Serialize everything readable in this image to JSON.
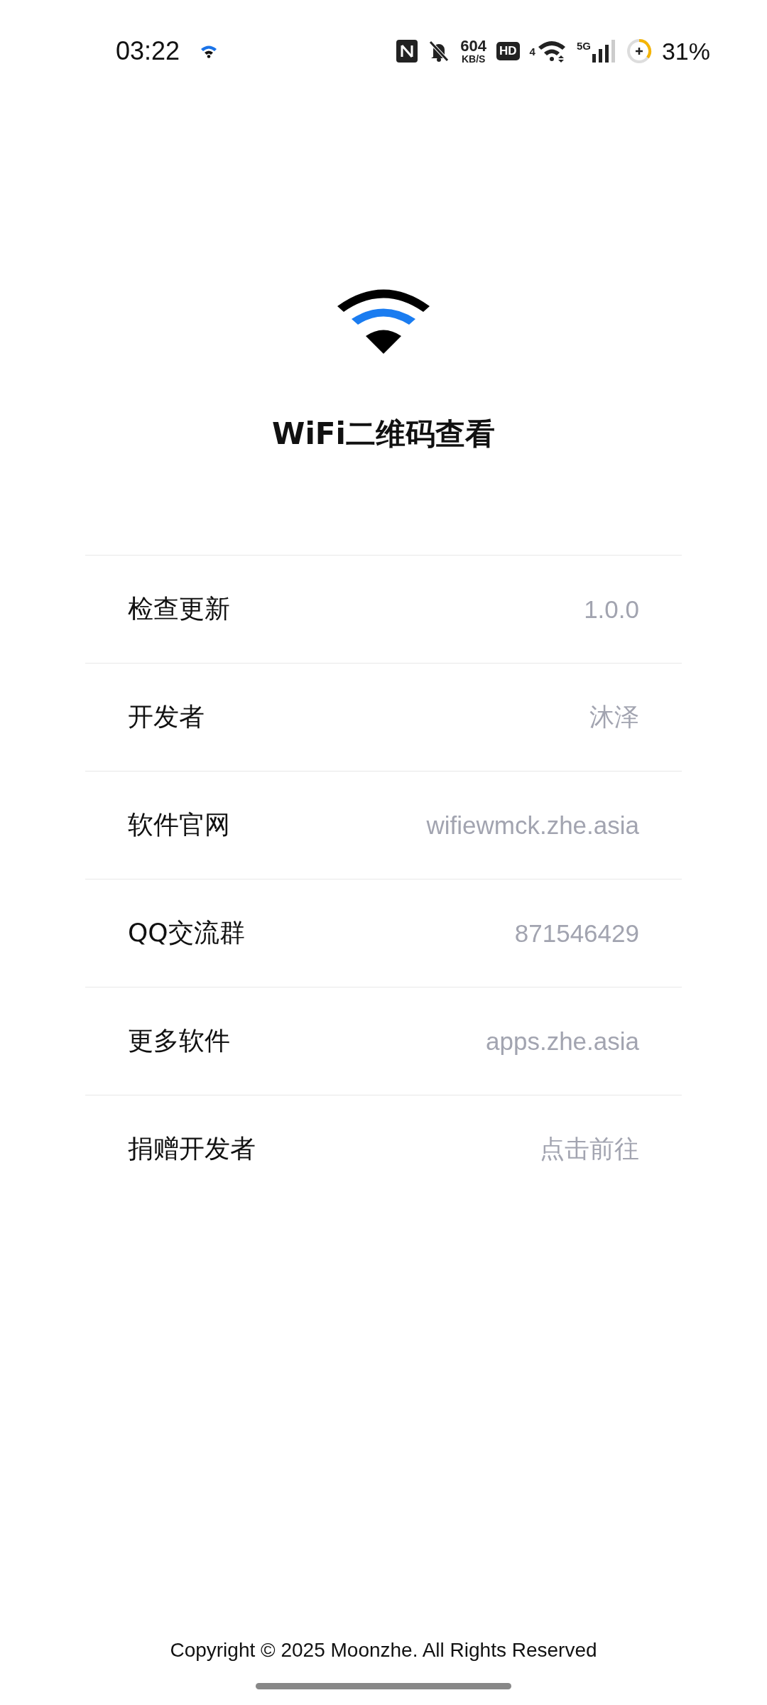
{
  "status_bar": {
    "time": "03:22",
    "net_speed": "604",
    "net_unit": "KB/S",
    "hd_badge": "HD",
    "wifi_gen": "4",
    "cell_gen": "5G",
    "battery": "31%"
  },
  "app": {
    "title": "WiFi二维码查看"
  },
  "rows": [
    {
      "label": "检查更新",
      "value": "1.0.0"
    },
    {
      "label": "开发者",
      "value": "沐泽"
    },
    {
      "label": "软件官网",
      "value": "wifiewmck.zhe.asia"
    },
    {
      "label": "QQ交流群",
      "value": "871546429"
    },
    {
      "label": "更多软件",
      "value": "apps.zhe.asia"
    },
    {
      "label": "捐赠开发者",
      "value": "点击前往"
    }
  ],
  "footer": {
    "copyright": "Copyright © 2025 Moonzhe. All Rights Reserved"
  }
}
